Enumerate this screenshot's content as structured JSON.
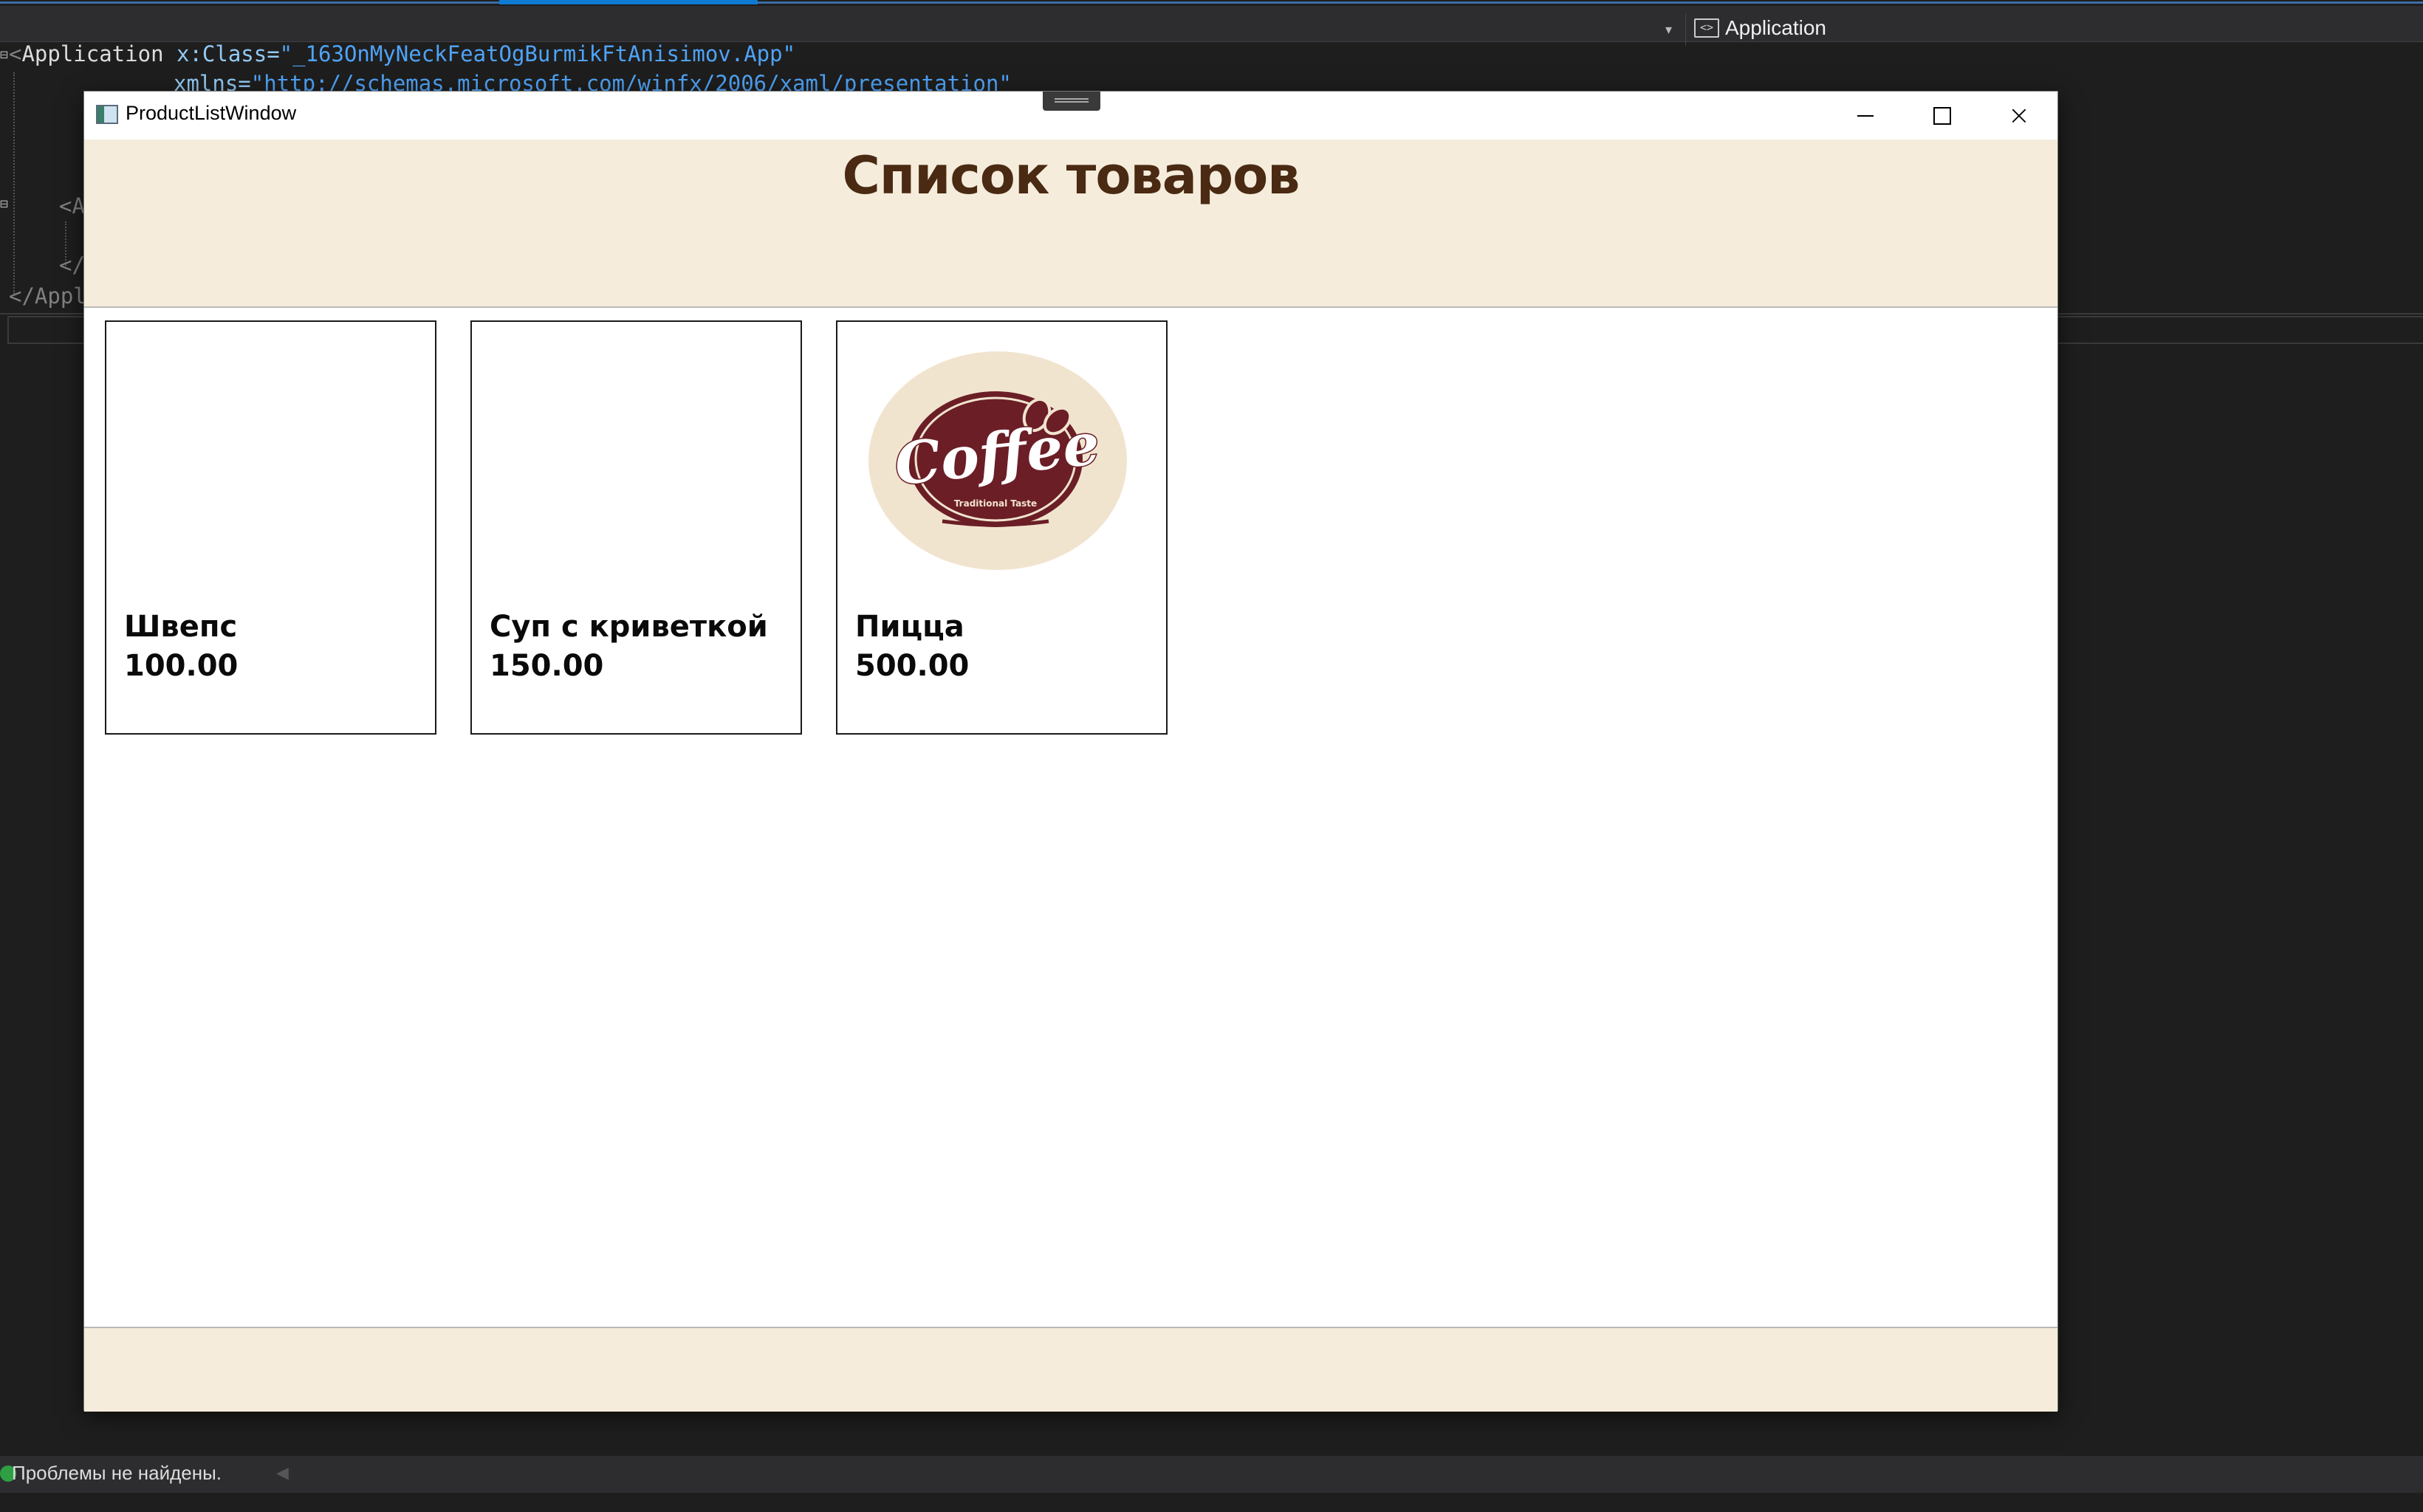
{
  "ide": {
    "navbar_item": "Application",
    "code_lines": [
      {
        "pre": "<",
        "name": "Application",
        "attr1": " x:Class=",
        "val1": "\"_163OnMyNeckFeatOgBurmikFtAnisimov.App\""
      },
      {
        "attr": "xmlns=",
        "val": "\"http://schemas.microsoft.com/winfx/2006/xaml/presentation\""
      }
    ],
    "code_fragment_a": "<A",
    "code_fragment_close": "</",
    "code_fragment_appl": "</Appl",
    "status_text": "Проблемы не найдены."
  },
  "window": {
    "title": "ProductListWindow",
    "header_title": "Список товаров",
    "controls": {
      "minimize": "minimize",
      "maximize": "maximize",
      "close": "×"
    }
  },
  "products": [
    {
      "name": "Швепс",
      "price": "100.00",
      "image": "none"
    },
    {
      "name": "Суп с криветкой",
      "price": "150.00",
      "image": "none"
    },
    {
      "name": "Пицца",
      "price": "500.00",
      "image": "coffee-logo",
      "image_text": "Coffee",
      "image_subtext": "Traditional Taste"
    }
  ],
  "colors": {
    "header_bg": "#f5ecdc",
    "title_color": "#4a2a12",
    "logo_bg": "#f1e4cf",
    "logo_badge": "#6b1e26"
  }
}
